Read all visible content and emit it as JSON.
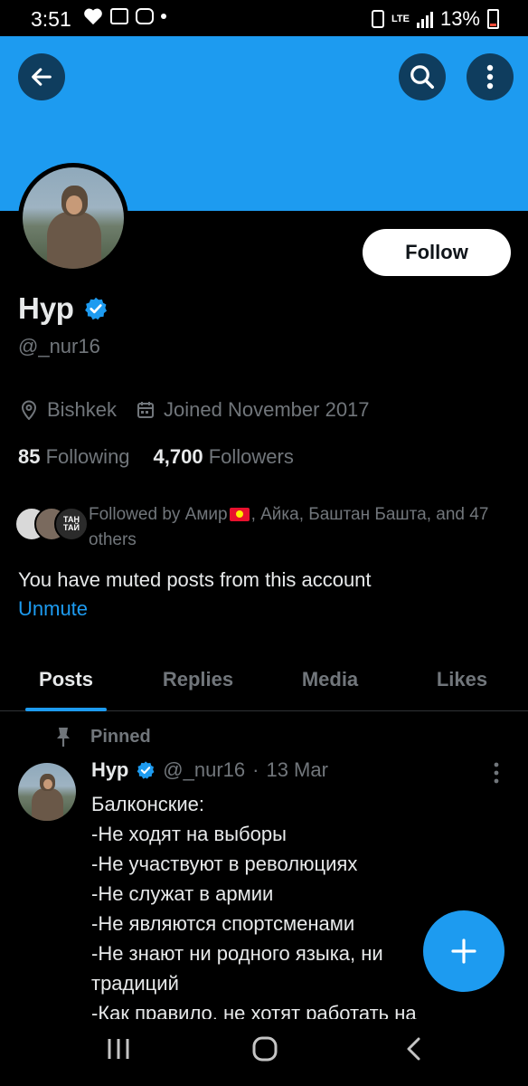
{
  "status_bar": {
    "time": "3:51",
    "battery": "13%",
    "network": "LTE",
    "icons": [
      "heart-icon",
      "gallery-icon",
      "instagram-icon",
      "notification-dot",
      "battery-saver-icon",
      "lte-icon",
      "signal-icon",
      "battery-icon"
    ]
  },
  "header": {
    "banner_color": "#1d9bf0",
    "back_icon": "arrow-left-icon",
    "search_icon": "search-icon",
    "more_icon": "more-vertical-icon"
  },
  "profile": {
    "name": "Нур",
    "handle": "@_nur16",
    "verified": true,
    "follow_label": "Follow",
    "location": "Bishkek",
    "joined": "Joined November 2017",
    "following_count": "85",
    "following_label": "Following",
    "followers_count": "4,700",
    "followers_label": "Followers",
    "followed_by_prefix": "Followed by Амир",
    "followed_by_rest": ", Айка, Баштан Башта, and 47 others",
    "followed_avatar_text": "ТАН ТАЙ",
    "muted_text": "You have muted posts from this account",
    "unmute_label": "Unmute"
  },
  "tabs": [
    {
      "label": "Posts",
      "active": true
    },
    {
      "label": "Replies",
      "active": false
    },
    {
      "label": "Media",
      "active": false
    },
    {
      "label": "Likes",
      "active": false
    }
  ],
  "tweet": {
    "pinned_label": "Pinned",
    "name": "Нур",
    "handle": "@_nur16",
    "separator": "·",
    "date": "13 Mar",
    "lines": [
      "Балконские:",
      "-Не ходят на выборы",
      "-Не участвуют в революциях",
      "-Не служат в армии",
      "-Не являются спортсменами",
      "-Не знают ни родного языка, ни традиций",
      "-Как правило, не хотят работать на"
    ]
  },
  "fab": {
    "icon": "plus-icon"
  },
  "nav": {
    "icons": [
      "recent-apps-icon",
      "home-icon",
      "back-icon"
    ]
  },
  "colors": {
    "accent": "#1d9bf0",
    "background": "#000000",
    "text": "#e7e9ea",
    "muted": "#71767b"
  }
}
